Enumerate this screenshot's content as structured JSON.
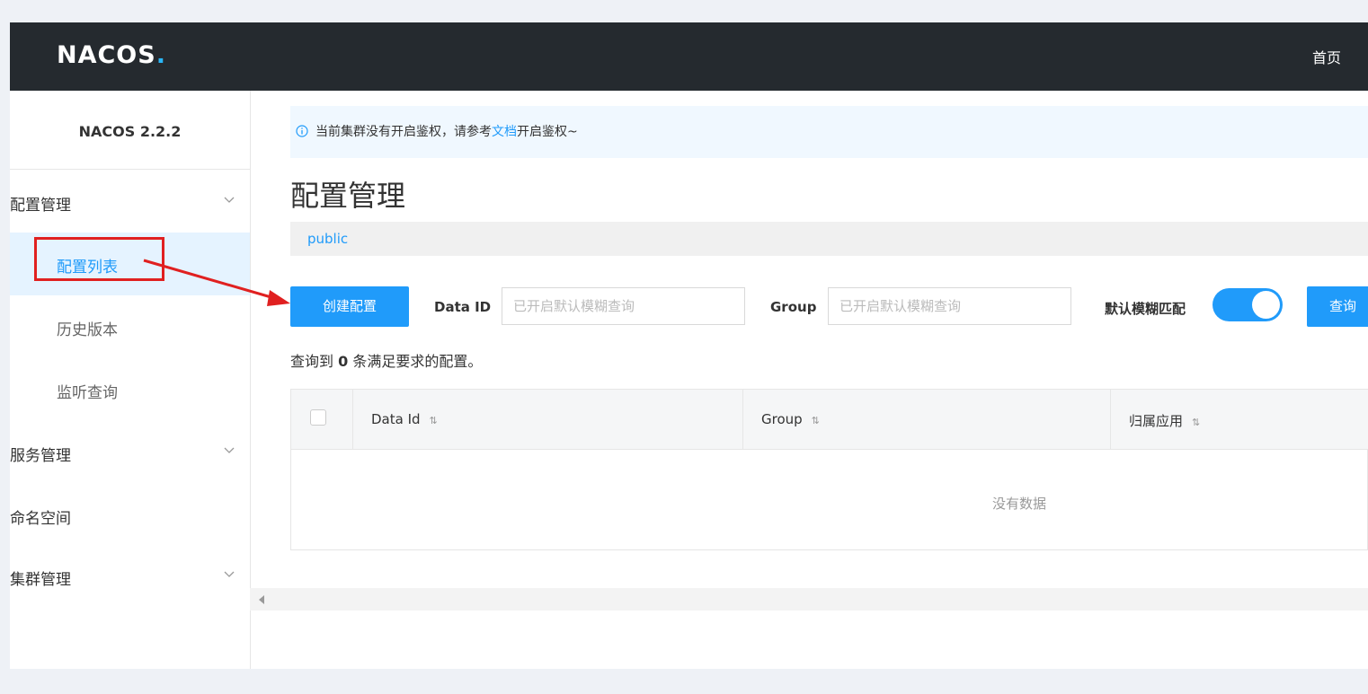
{
  "header": {
    "logo": "NACOS",
    "logo_dot": ".",
    "home_link": "首页"
  },
  "sidebar": {
    "version": "NACOS 2.2.2",
    "config_mgmt": "配置管理",
    "config_list": "配置列表",
    "history": "历史版本",
    "listen_query": "监听查询",
    "service_mgmt": "服务管理",
    "namespace": "命名空间",
    "cluster_mgmt": "集群管理"
  },
  "alert": {
    "text_before": "当前集群没有开启鉴权，请参考",
    "link": "文档",
    "text_after": "开启鉴权~"
  },
  "page": {
    "title": "配置管理",
    "namespace": "public"
  },
  "toolbar": {
    "create_label": "创建配置",
    "data_id_label": "Data ID",
    "data_id_placeholder": "已开启默认模糊查询",
    "group_label": "Group",
    "group_placeholder": "已开启默认模糊查询",
    "fuzzy_label": "默认模糊匹配",
    "fuzzy_enabled": true,
    "query_label": "查询"
  },
  "result": {
    "prefix": "查询到",
    "count": "0",
    "suffix": "条满足要求的配置。"
  },
  "table": {
    "columns": [
      "Data Id",
      "Group",
      "归属应用"
    ],
    "sort_icon": "⇅",
    "empty_text": "没有数据"
  },
  "colors": {
    "accent": "#209bfa",
    "topbar": "#252a2f",
    "annotation": "#e02020"
  }
}
